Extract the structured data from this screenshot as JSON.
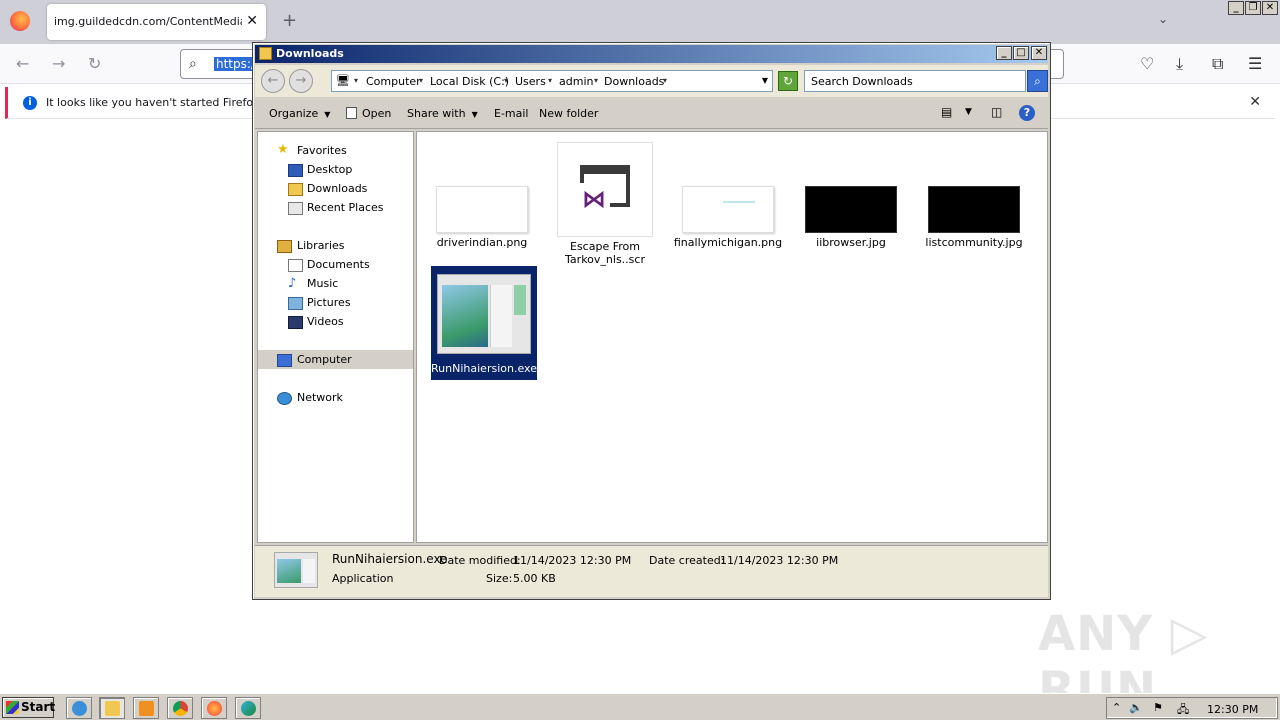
{
  "browser": {
    "tab_title": "img.guildedcdn.com/ContentMediaGenericFiles/",
    "url_text": "https:/",
    "notice_text": "It looks like you haven't started Firefox in a"
  },
  "explorer": {
    "title": "Downloads",
    "breadcrumbs": [
      "Computer",
      "Local Disk (C:)",
      "Users",
      "admin",
      "Downloads"
    ],
    "search_placeholder": "Search Downloads",
    "toolbar": {
      "organize": "Organize",
      "open": "Open",
      "share_with": "Share with",
      "email": "E-mail",
      "new_folder": "New folder"
    },
    "nav": {
      "favorites": "Favorites",
      "desktop": "Desktop",
      "downloads": "Downloads",
      "recent_places": "Recent Places",
      "libraries": "Libraries",
      "documents": "Documents",
      "music": "Music",
      "pictures": "Pictures",
      "videos": "Videos",
      "computer": "Computer",
      "network": "Network"
    },
    "files": [
      {
        "name": "driverindian.png"
      },
      {
        "name": "Escape From Tarkov_nls..scr"
      },
      {
        "name": "finallymichigan.png"
      },
      {
        "name": "iibrowser.jpg"
      },
      {
        "name": "listcommunity.jpg"
      },
      {
        "name": "RunNihaiersion.exe"
      }
    ],
    "details": {
      "name": "RunNihaiersion.exe",
      "type": "Application",
      "date_modified_label": "Date modified:",
      "date_modified": "11/14/2023 12:30 PM",
      "date_created_label": "Date created:",
      "date_created": "11/14/2023 12:30 PM",
      "size_label": "Size:",
      "size": "5.00 KB"
    }
  },
  "taskbar": {
    "start_label": "Start",
    "clock": "12:30 PM"
  },
  "watermark": "ANY RUN",
  "colors": {
    "selection": "#0a246a",
    "titlebar_start": "#0a246a",
    "titlebar_end": "#a6caf0",
    "vs_purple": "#68217a"
  }
}
